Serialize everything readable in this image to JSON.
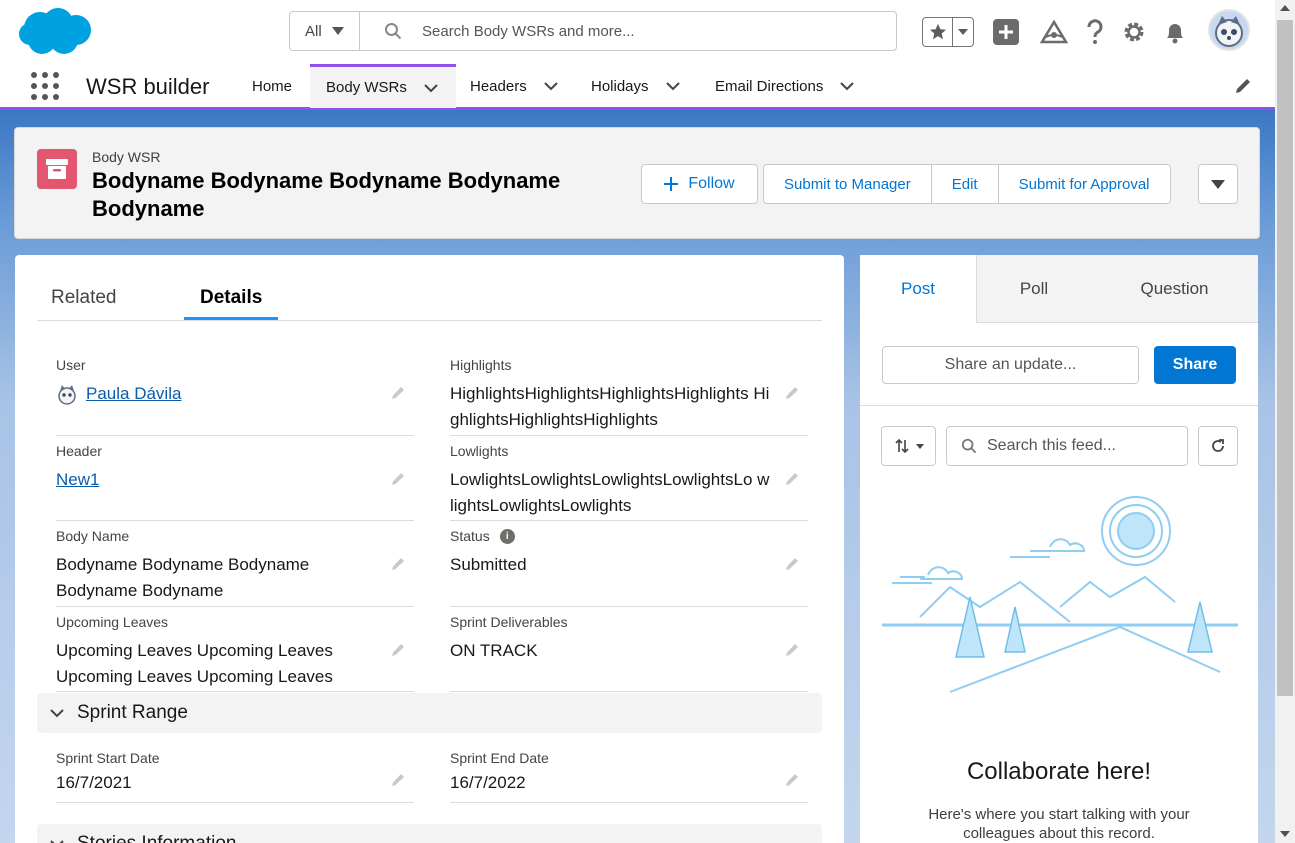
{
  "header": {
    "search_scope": "All",
    "search_placeholder": "Search Body WSRs and more..."
  },
  "nav": {
    "app_name": "WSR builder",
    "items": [
      {
        "label": "Home"
      },
      {
        "label": "Body WSRs"
      },
      {
        "label": "Headers"
      },
      {
        "label": "Holidays"
      },
      {
        "label": "Email Directions"
      }
    ]
  },
  "record": {
    "object_label": "Body WSR",
    "title": "Bodyname Bodyname Bodyname Bodyname Bodyname",
    "follow_label": "Follow",
    "actions": [
      "Submit to Manager",
      "Edit",
      "Submit for Approval"
    ]
  },
  "detail": {
    "tabs": [
      "Related",
      "Details"
    ],
    "fields": {
      "user": {
        "label": "User",
        "value": "Paula Dávila"
      },
      "highlights": {
        "label": "Highlights",
        "value": "HighlightsHighlightsHighlightsHighlights HighlightsHighlightsHighlights"
      },
      "header": {
        "label": "Header",
        "value": "New1"
      },
      "lowlights": {
        "label": "Lowlights",
        "value": "LowlightsLowlightsLowlightsLowlightsLo wlightsLowlightsLowlights"
      },
      "body_name": {
        "label": "Body Name",
        "value": "Bodyname Bodyname Bodyname Bodyname Bodyname"
      },
      "status": {
        "label": "Status",
        "value": "Submitted"
      },
      "upcoming_leaves": {
        "label": "Upcoming Leaves",
        "value": "Upcoming Leaves Upcoming Leaves Upcoming Leaves Upcoming Leaves"
      },
      "sprint_deliverables": {
        "label": "Sprint Deliverables",
        "value": "ON TRACK"
      },
      "sprint_start": {
        "label": "Sprint Start Date",
        "value": "16/7/2021"
      },
      "sprint_end": {
        "label": "Sprint End Date",
        "value": "16/7/2022"
      }
    },
    "sections": {
      "sprint_range": "Sprint Range",
      "next_section": "Stories Information"
    }
  },
  "feed": {
    "tabs": [
      "Post",
      "Poll",
      "Question"
    ],
    "share_placeholder": "Share an update...",
    "share_label": "Share",
    "search_placeholder": "Search this feed...",
    "empty_title": "Collaborate here!",
    "empty_body": "Here's where you start talking with your colleagues about this record."
  },
  "colors": {
    "brand": "#0176d3",
    "nav_accent": "#9050e9",
    "object_icon": "#e3566f"
  }
}
